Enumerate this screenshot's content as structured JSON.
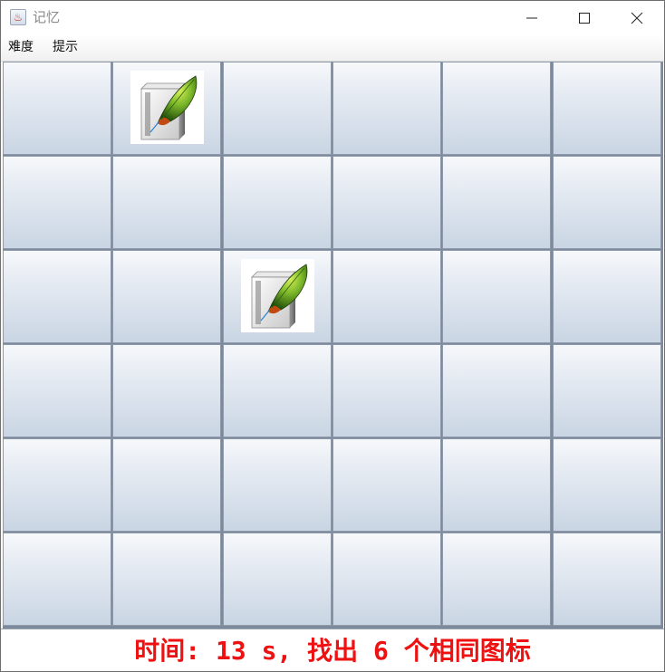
{
  "window": {
    "title": "记忆",
    "icon": "java-cup-icon",
    "controls": [
      "minimize-icon",
      "maximize-icon",
      "close-icon"
    ]
  },
  "menu": {
    "items": [
      {
        "label": "难度"
      },
      {
        "label": "提示"
      }
    ]
  },
  "board": {
    "rows": 6,
    "cols": 6,
    "revealed": [
      {
        "row": 0,
        "col": 1,
        "icon": "feather-document-icon"
      },
      {
        "row": 2,
        "col": 2,
        "icon": "feather-document-icon"
      }
    ]
  },
  "status": {
    "text": "时间: 13 s, 找出 6 个相同图标",
    "color": "#ee1111"
  }
}
